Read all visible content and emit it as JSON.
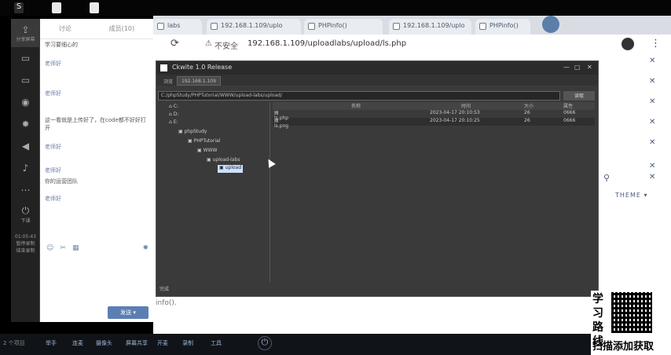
{
  "browser": {
    "tabs": [
      {
        "label": "labs"
      },
      {
        "label": "192.168.1.109/uplo"
      },
      {
        "label": "PHPinfo()"
      },
      {
        "label": "192.168.1.109/uplo"
      },
      {
        "label": "PHPinfo()"
      }
    ],
    "security_label": "不安全",
    "url": "192.168.1.109/uploadlabs/upload/ls.php"
  },
  "chat": {
    "tabs": [
      "讨论",
      "成员(10)"
    ],
    "messages": [
      "学习要细心的",
      "老师好",
      "老师好",
      "这一看就是上传好了，在code都不好好打开",
      "老师好",
      "老师好",
      "你的运营团队",
      "老师好"
    ]
  },
  "sidebar": {
    "share_label": "分享屏幕",
    "bottom_label": "下课",
    "time_label": "01:05:43",
    "record_label": "暂停录制",
    "end_label": "结束录制"
  },
  "dialog": {
    "title": "Ckwite 1.0 Release",
    "tabs": [
      "浏览",
      "192.168.1.109"
    ],
    "path": "C:/phpStudy/PHPTutorial/WWW/upload-labs/upload/",
    "go_button": "读取",
    "tree": [
      "C:",
      "D:",
      "E:",
      "phpStudy",
      "PHPTutorial",
      "WWW",
      "upload-labs",
      "upload"
    ],
    "columns": [
      "名称",
      "时间",
      "大小",
      "属性"
    ],
    "files": [
      {
        "name": "ls.php",
        "time": "2023-04-17 20:10:53",
        "size": "26",
        "attr": "0666"
      },
      {
        "name": "ls.png",
        "time": "2023-04-17 20:10:25",
        "size": "26",
        "attr": "0666"
      }
    ],
    "status": "完成"
  },
  "page": {
    "output_text": "info().",
    "theme_label": "THEME"
  },
  "taskbar": {
    "items_count": "2 个项目",
    "buttons": [
      "举手",
      "连麦",
      "摄像头",
      "屏幕共享",
      "开麦",
      "录制",
      "工具"
    ]
  },
  "promo": {
    "vertical_text": "学习路线",
    "bottom_text": "扫描添加获取"
  },
  "chat_input": {
    "send_label": "发送"
  }
}
